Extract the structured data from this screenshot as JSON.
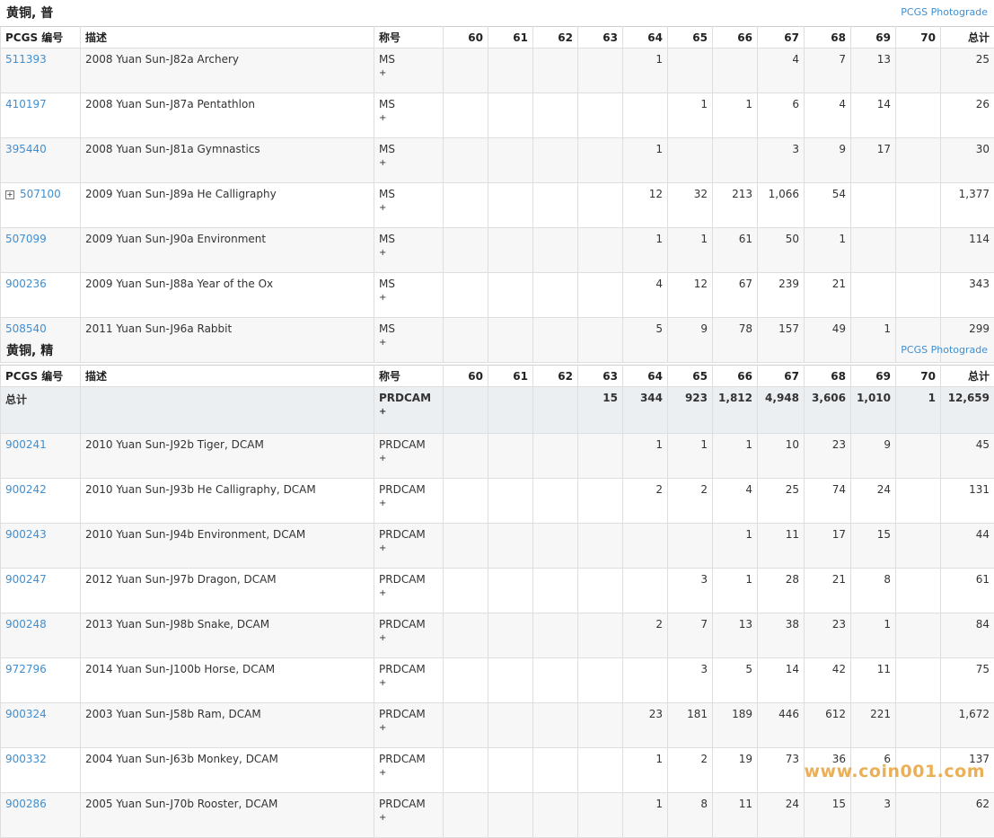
{
  "columns": [
    "PCGS 编号",
    "描述",
    "称号",
    "60",
    "61",
    "62",
    "63",
    "64",
    "65",
    "66",
    "67",
    "68",
    "69",
    "70",
    "总计"
  ],
  "photograde_label": "PCGS Photograde",
  "sections": [
    {
      "title": "黄铜, 普",
      "rows": [
        {
          "code": "511393",
          "desc": "2008 Yuan Sun-J82a Archery",
          "prefix": "MS",
          "plus": "+",
          "counts": [
            "",
            "",
            "",
            "",
            "1",
            "",
            "",
            "4",
            "7",
            "13",
            "",
            "25"
          ]
        },
        {
          "code": "410197",
          "desc": "2008 Yuan Sun-J87a Pentathlon",
          "prefix": "MS",
          "plus": "+",
          "counts": [
            "",
            "",
            "",
            "",
            "",
            "1",
            "1",
            "6",
            "4",
            "14",
            "",
            "26"
          ]
        },
        {
          "code": "395440",
          "desc": "2008 Yuan Sun-J81a Gymnastics",
          "prefix": "MS",
          "plus": "+",
          "counts": [
            "",
            "",
            "",
            "",
            "1",
            "",
            "",
            "3",
            "9",
            "17",
            "",
            "30"
          ]
        },
        {
          "code": "507100",
          "desc": "2009 Yuan Sun-J89a He Calligraphy",
          "prefix": "MS",
          "plus": "+",
          "expand": "+",
          "counts": [
            "",
            "",
            "",
            "",
            "12",
            "32",
            "213",
            "1,066",
            "54",
            "",
            "",
            "1,377"
          ]
        },
        {
          "code": "507099",
          "desc": "2009 Yuan Sun-J90a Environment",
          "prefix": "MS",
          "plus": "+",
          "counts": [
            "",
            "",
            "",
            "",
            "1",
            "1",
            "61",
            "50",
            "1",
            "",
            "",
            "114"
          ]
        },
        {
          "code": "900236",
          "desc": "2009 Yuan Sun-J88a Year of the Ox",
          "prefix": "MS",
          "plus": "+",
          "counts": [
            "",
            "",
            "",
            "",
            "4",
            "12",
            "67",
            "239",
            "21",
            "",
            "",
            "343"
          ]
        },
        {
          "code": "508540",
          "desc": "2011 Yuan Sun-J96a Rabbit",
          "prefix": "MS",
          "plus": "+",
          "counts": [
            "",
            "",
            "",
            "",
            "5",
            "9",
            "78",
            "157",
            "49",
            "1",
            "",
            "299"
          ]
        }
      ]
    },
    {
      "title": "黄铜, 精",
      "total": {
        "label": "总计",
        "prefix": "PRDCAM",
        "plus": "+",
        "counts": [
          "",
          "",
          "",
          "15",
          "344",
          "923",
          "1,812",
          "4,948",
          "3,606",
          "1,010",
          "1",
          "12,659"
        ]
      },
      "rows": [
        {
          "code": "900241",
          "desc": "2010 Yuan Sun-J92b Tiger, DCAM",
          "prefix": "PRDCAM",
          "plus": "+",
          "counts": [
            "",
            "",
            "",
            "",
            "1",
            "1",
            "1",
            "10",
            "23",
            "9",
            "",
            "45"
          ]
        },
        {
          "code": "900242",
          "desc": "2010 Yuan Sun-J93b He Calligraphy, DCAM",
          "prefix": "PRDCAM",
          "plus": "+",
          "counts": [
            "",
            "",
            "",
            "",
            "2",
            "2",
            "4",
            "25",
            "74",
            "24",
            "",
            "131"
          ]
        },
        {
          "code": "900243",
          "desc": "2010 Yuan Sun-J94b Environment, DCAM",
          "prefix": "PRDCAM",
          "plus": "+",
          "counts": [
            "",
            "",
            "",
            "",
            "",
            "",
            "1",
            "11",
            "17",
            "15",
            "",
            "44"
          ]
        },
        {
          "code": "900247",
          "desc": "2012 Yuan Sun-J97b Dragon, DCAM",
          "prefix": "PRDCAM",
          "plus": "+",
          "counts": [
            "",
            "",
            "",
            "",
            "",
            "3",
            "1",
            "28",
            "21",
            "8",
            "",
            "61"
          ]
        },
        {
          "code": "900248",
          "desc": "2013 Yuan Sun-J98b Snake, DCAM",
          "prefix": "PRDCAM",
          "plus": "+",
          "counts": [
            "",
            "",
            "",
            "",
            "2",
            "7",
            "13",
            "38",
            "23",
            "1",
            "",
            "84"
          ]
        },
        {
          "code": "972796",
          "desc": "2014 Yuan Sun-J100b Horse, DCAM",
          "prefix": "PRDCAM",
          "plus": "+",
          "counts": [
            "",
            "",
            "",
            "",
            "",
            "3",
            "5",
            "14",
            "42",
            "11",
            "",
            "75"
          ]
        },
        {
          "code": "900324",
          "desc": "2003 Yuan Sun-J58b Ram, DCAM",
          "prefix": "PRDCAM",
          "plus": "+",
          "counts": [
            "",
            "",
            "",
            "",
            "23",
            "181",
            "189",
            "446",
            "612",
            "221",
            "",
            "1,672"
          ]
        },
        {
          "code": "900332",
          "desc": "2004 Yuan Sun-J63b Monkey, DCAM",
          "prefix": "PRDCAM",
          "plus": "+",
          "counts": [
            "",
            "",
            "",
            "",
            "1",
            "2",
            "19",
            "73",
            "36",
            "6",
            "",
            "137"
          ]
        },
        {
          "code": "900286",
          "desc": "2005 Yuan Sun-J70b Rooster, DCAM",
          "prefix": "PRDCAM",
          "plus": "+",
          "counts": [
            "",
            "",
            "",
            "",
            "1",
            "8",
            "11",
            "24",
            "15",
            "3",
            "",
            "62"
          ]
        }
      ]
    }
  ],
  "watermark": "www.coin001.com",
  "colors": {
    "link": "#3f8fd2",
    "watermark": "#e8a33a",
    "total_row_bg": "#eceff2",
    "odd_row_bg": "#f7f7f7"
  }
}
